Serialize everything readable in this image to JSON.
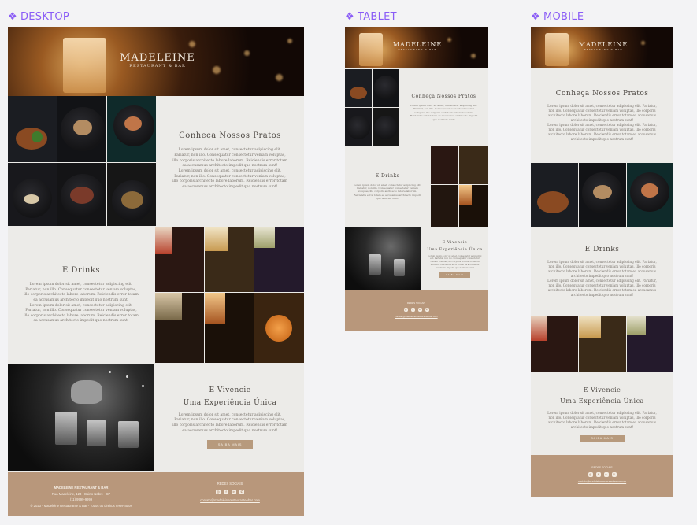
{
  "labels": {
    "desktop": "DESKTOP",
    "tablet": "TABLET",
    "mobile": "MOBILE"
  },
  "brand": {
    "title": "MADELEINE",
    "subtitle": "RESTAURANT & BAR"
  },
  "sections": {
    "pratos": {
      "title": "Conheça Nossos Pratos",
      "body": "Lorem ipsum dolor sit amet, consectetur adipiscing elit. Pariatur, non illo. Consequatur consectetur veniam voluptas, illo corporis architecto labore laborum. Reiciendis error totam ea accusamus architecto impedit quo nostrum sunt!",
      "body2": "Lorem ipsum dolor sit amet, consectetur adipiscing elit. Pariatur, non illo. Consequatur consectetur veniam voluptas, illo corporis architecto labore laborum. Reiciendis error totam ea accusamus architecto impedit quo nostrum sunt!"
    },
    "drinks": {
      "title": "E Drinks",
      "body": "Lorem ipsum dolor sit amet, consectetur adipiscing elit. Pariatur, non illo. Consequatur consectetur veniam voluptas, illo corporis architecto labore laborum. Reiciendis error totam ea accusamus architecto impedit quo nostrum sunt!",
      "body2": "Lorem ipsum dolor sit amet, consectetur adipiscing elit. Pariatur, non illo. Consequatur consectetur veniam voluptas, illo corporis architecto labore laborum. Reiciendis error totam ea accusamus architecto impedit quo nostrum sunt!"
    },
    "vivencie": {
      "title1": "E Vivencie",
      "title2": "Uma Experiência Única",
      "body": "Lorem ipsum dolor sit amet, consectetur adipiscing elit. Pariatur, non illo. Consequatur consectetur veniam voluptas, illo corporis architecto labore laborum. Reiciendis error totam ea accusamus architecto impedit quo nostrum sunt!",
      "button": "SAIBA MAIS"
    }
  },
  "footer": {
    "company": "MADELEINE RESTAURANT & BAR",
    "address": "Rua Madeleine, 123 - Bairro Nobre - SP",
    "phone": "(11) 9999-9999",
    "copyright": "© 2023 - Madeleine Restaurante & Bar - Todos os direitos reservados",
    "social_title": "REDES SOCIAIS",
    "email": "contato@madeleinerestauranteebar.com",
    "icons": [
      "instagram-icon",
      "facebook-icon",
      "linkedin-icon",
      "whatsapp-icon"
    ],
    "icon_glyphs": [
      "◎",
      "f",
      "in",
      "✆"
    ]
  },
  "colors": {
    "accent": "#8a5cf6",
    "footer": "#b8977b",
    "panel": "#ecebe8",
    "button": "#b79a7d"
  }
}
